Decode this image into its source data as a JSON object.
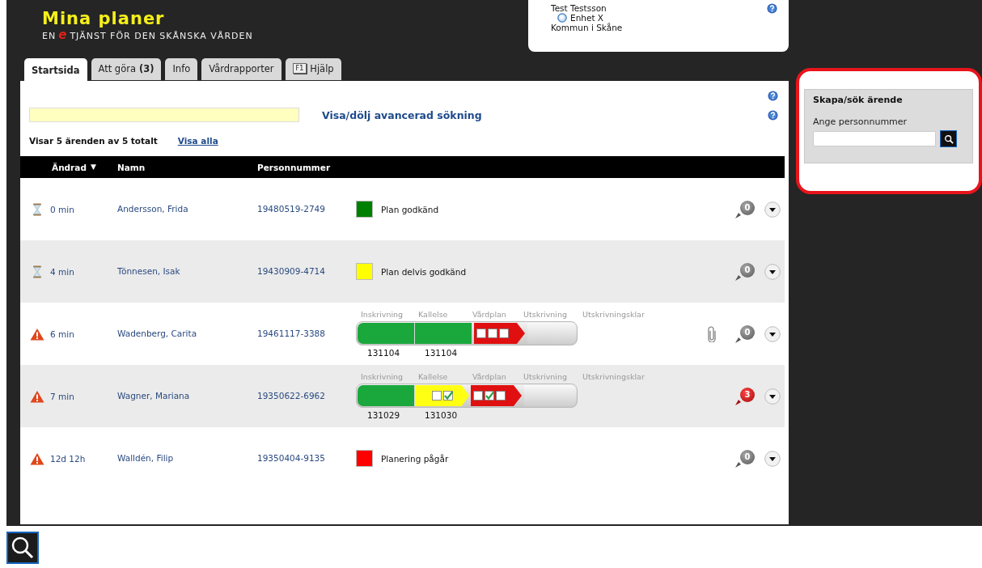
{
  "logo": {
    "title": "Mina planer",
    "prefix": "EN",
    "e_mark": "e",
    "subtitle": "TJÄNST FÖR DEN SKÅNSKA VÅRDEN"
  },
  "tabs": [
    {
      "label": "Startsida",
      "selected": true
    },
    {
      "label": "Att göra **(3)**",
      "selected": false
    },
    {
      "label": "Info",
      "selected": false
    },
    {
      "label": "Vårdrapporter",
      "selected": false
    },
    {
      "label": "Hjälp",
      "key": "F1",
      "selected": false
    }
  ],
  "user": {
    "name": "Test Testsson",
    "unit": "Enhet X",
    "municipality": "Kommun i Skåne"
  },
  "search": {
    "link": "Visa/dölj avancerad sökning"
  },
  "summary": {
    "text": "Visar 5 ärenden av 5 totalt",
    "link": "Visa alla"
  },
  "table": {
    "columns": [
      {
        "label": "Ändrad",
        "sort_mark": "▼"
      },
      {
        "label": "Namn"
      },
      {
        "label": "Personnummer"
      }
    ],
    "rows": [
      {
        "alert": false,
        "time": "0 min",
        "name": "Andersson, Frida",
        "pnr": "19480519-2749",
        "kind": "status",
        "status": {
          "color": "#008000",
          "text": "Plan godkänd"
        },
        "attachment": false,
        "comments": "0",
        "unread": false
      },
      {
        "alert": false,
        "time": "4 min",
        "name": "Tönnesen, Isak",
        "pnr": "19430909-4714",
        "kind": "status",
        "status": {
          "color": "#ffff00",
          "text": "Plan delvis godkänd"
        },
        "attachment": false,
        "comments": "0",
        "unread": false
      },
      {
        "alert": true,
        "time": "6 min",
        "name": "Wadenberg, Carita",
        "pnr": "19461117-3388",
        "kind": "pipeline",
        "stages": [
          {
            "label": "Inskrivning",
            "kind": "done",
            "date": "131104"
          },
          {
            "label": "Kallelse",
            "kind": "done",
            "date": "131104"
          },
          {
            "label": "Vårdplan",
            "kind": "active",
            "checks": [
              false,
              false,
              false
            ]
          },
          {
            "label": "Utskrivning",
            "kind": "empty"
          },
          {
            "label": "Utskrivningsklar",
            "kind": "none"
          }
        ],
        "attachment": true,
        "comments": "0",
        "unread": false
      },
      {
        "alert": true,
        "time": "7 min",
        "name": "Wagner, Mariana",
        "pnr": "19350622-6962",
        "kind": "pipeline",
        "stages": [
          {
            "label": "Inskrivning",
            "kind": "done",
            "date": "131029"
          },
          {
            "label": "Kallelse",
            "kind": "partial",
            "checks": [
              false,
              true
            ],
            "date": "131030"
          },
          {
            "label": "Vårdplan",
            "kind": "active",
            "checks": [
              false,
              true,
              false
            ]
          },
          {
            "label": "Utskrivning",
            "kind": "empty"
          },
          {
            "label": "Utskrivningsklar",
            "kind": "none"
          }
        ],
        "attachment": false,
        "comments": "3",
        "unread": true
      },
      {
        "alert": true,
        "time": "12d 12h",
        "name": "Walldén, Filip",
        "pnr": "19350404-9135",
        "kind": "status",
        "status": {
          "color": "#ff0000",
          "text": "Planering pågår"
        },
        "attachment": false,
        "comments": "0",
        "unread": false
      }
    ]
  },
  "sidebar": {
    "title": "Skapa/sök ärende",
    "label": "Ange personnummer"
  }
}
